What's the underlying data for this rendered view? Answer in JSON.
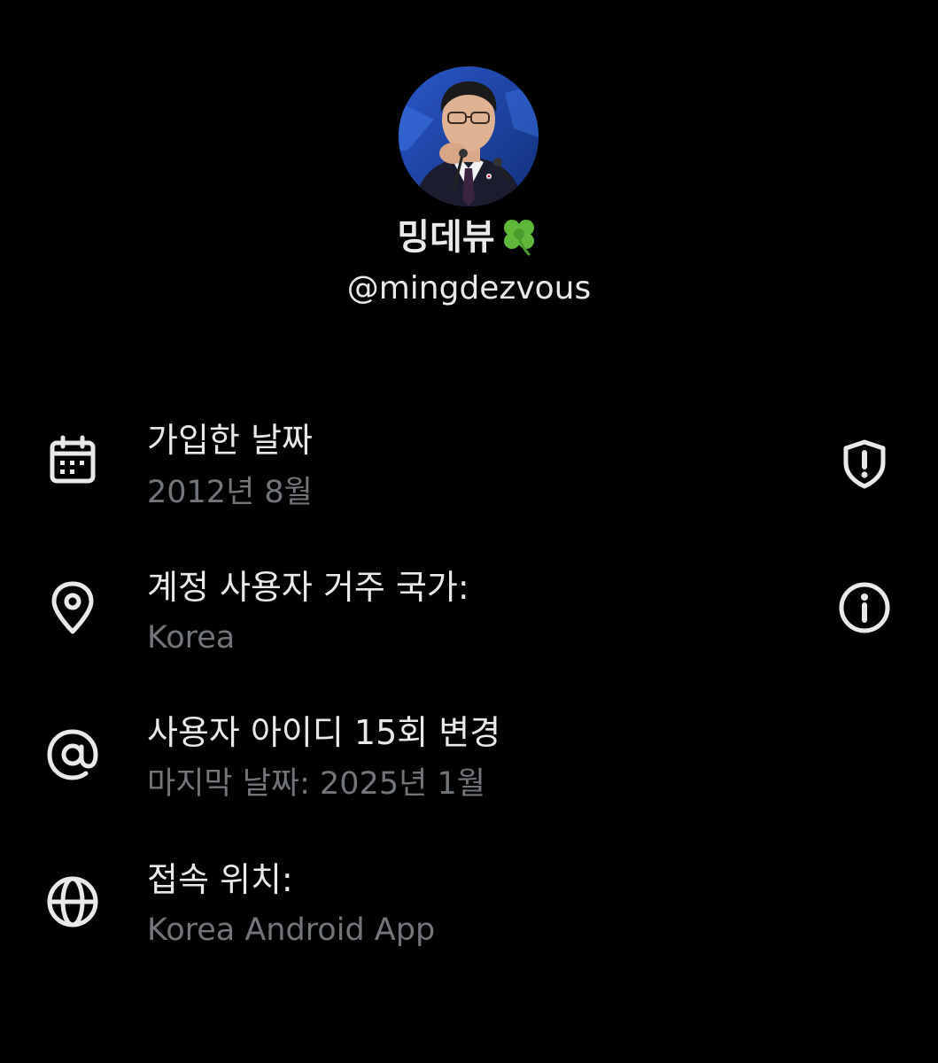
{
  "profile": {
    "display_name": "밍데뷰",
    "name_emoji": "four-leaf-clover",
    "handle": "@mingdezvous",
    "avatar": "profile-photo"
  },
  "rows": [
    {
      "icon": "calendar-icon",
      "title": "가입한 날짜",
      "subtitle": "2012년 8월",
      "action_icon": "shield-alert-icon"
    },
    {
      "icon": "location-pin-icon",
      "title": "계정 사용자 거주 국가:",
      "subtitle": "Korea",
      "action_icon": "info-icon"
    },
    {
      "icon": "at-sign-icon",
      "title": "사용자 아이디 15회 변경",
      "subtitle": "마지막 날짜: 2025년 1월"
    },
    {
      "icon": "globe-icon",
      "title": "접속 위치:",
      "subtitle": "Korea Android App"
    }
  ],
  "colors": {
    "background": "#000000",
    "primary_text": "#e7e9ea",
    "secondary_text": "#71767b",
    "icon": "#e7e9ea"
  }
}
